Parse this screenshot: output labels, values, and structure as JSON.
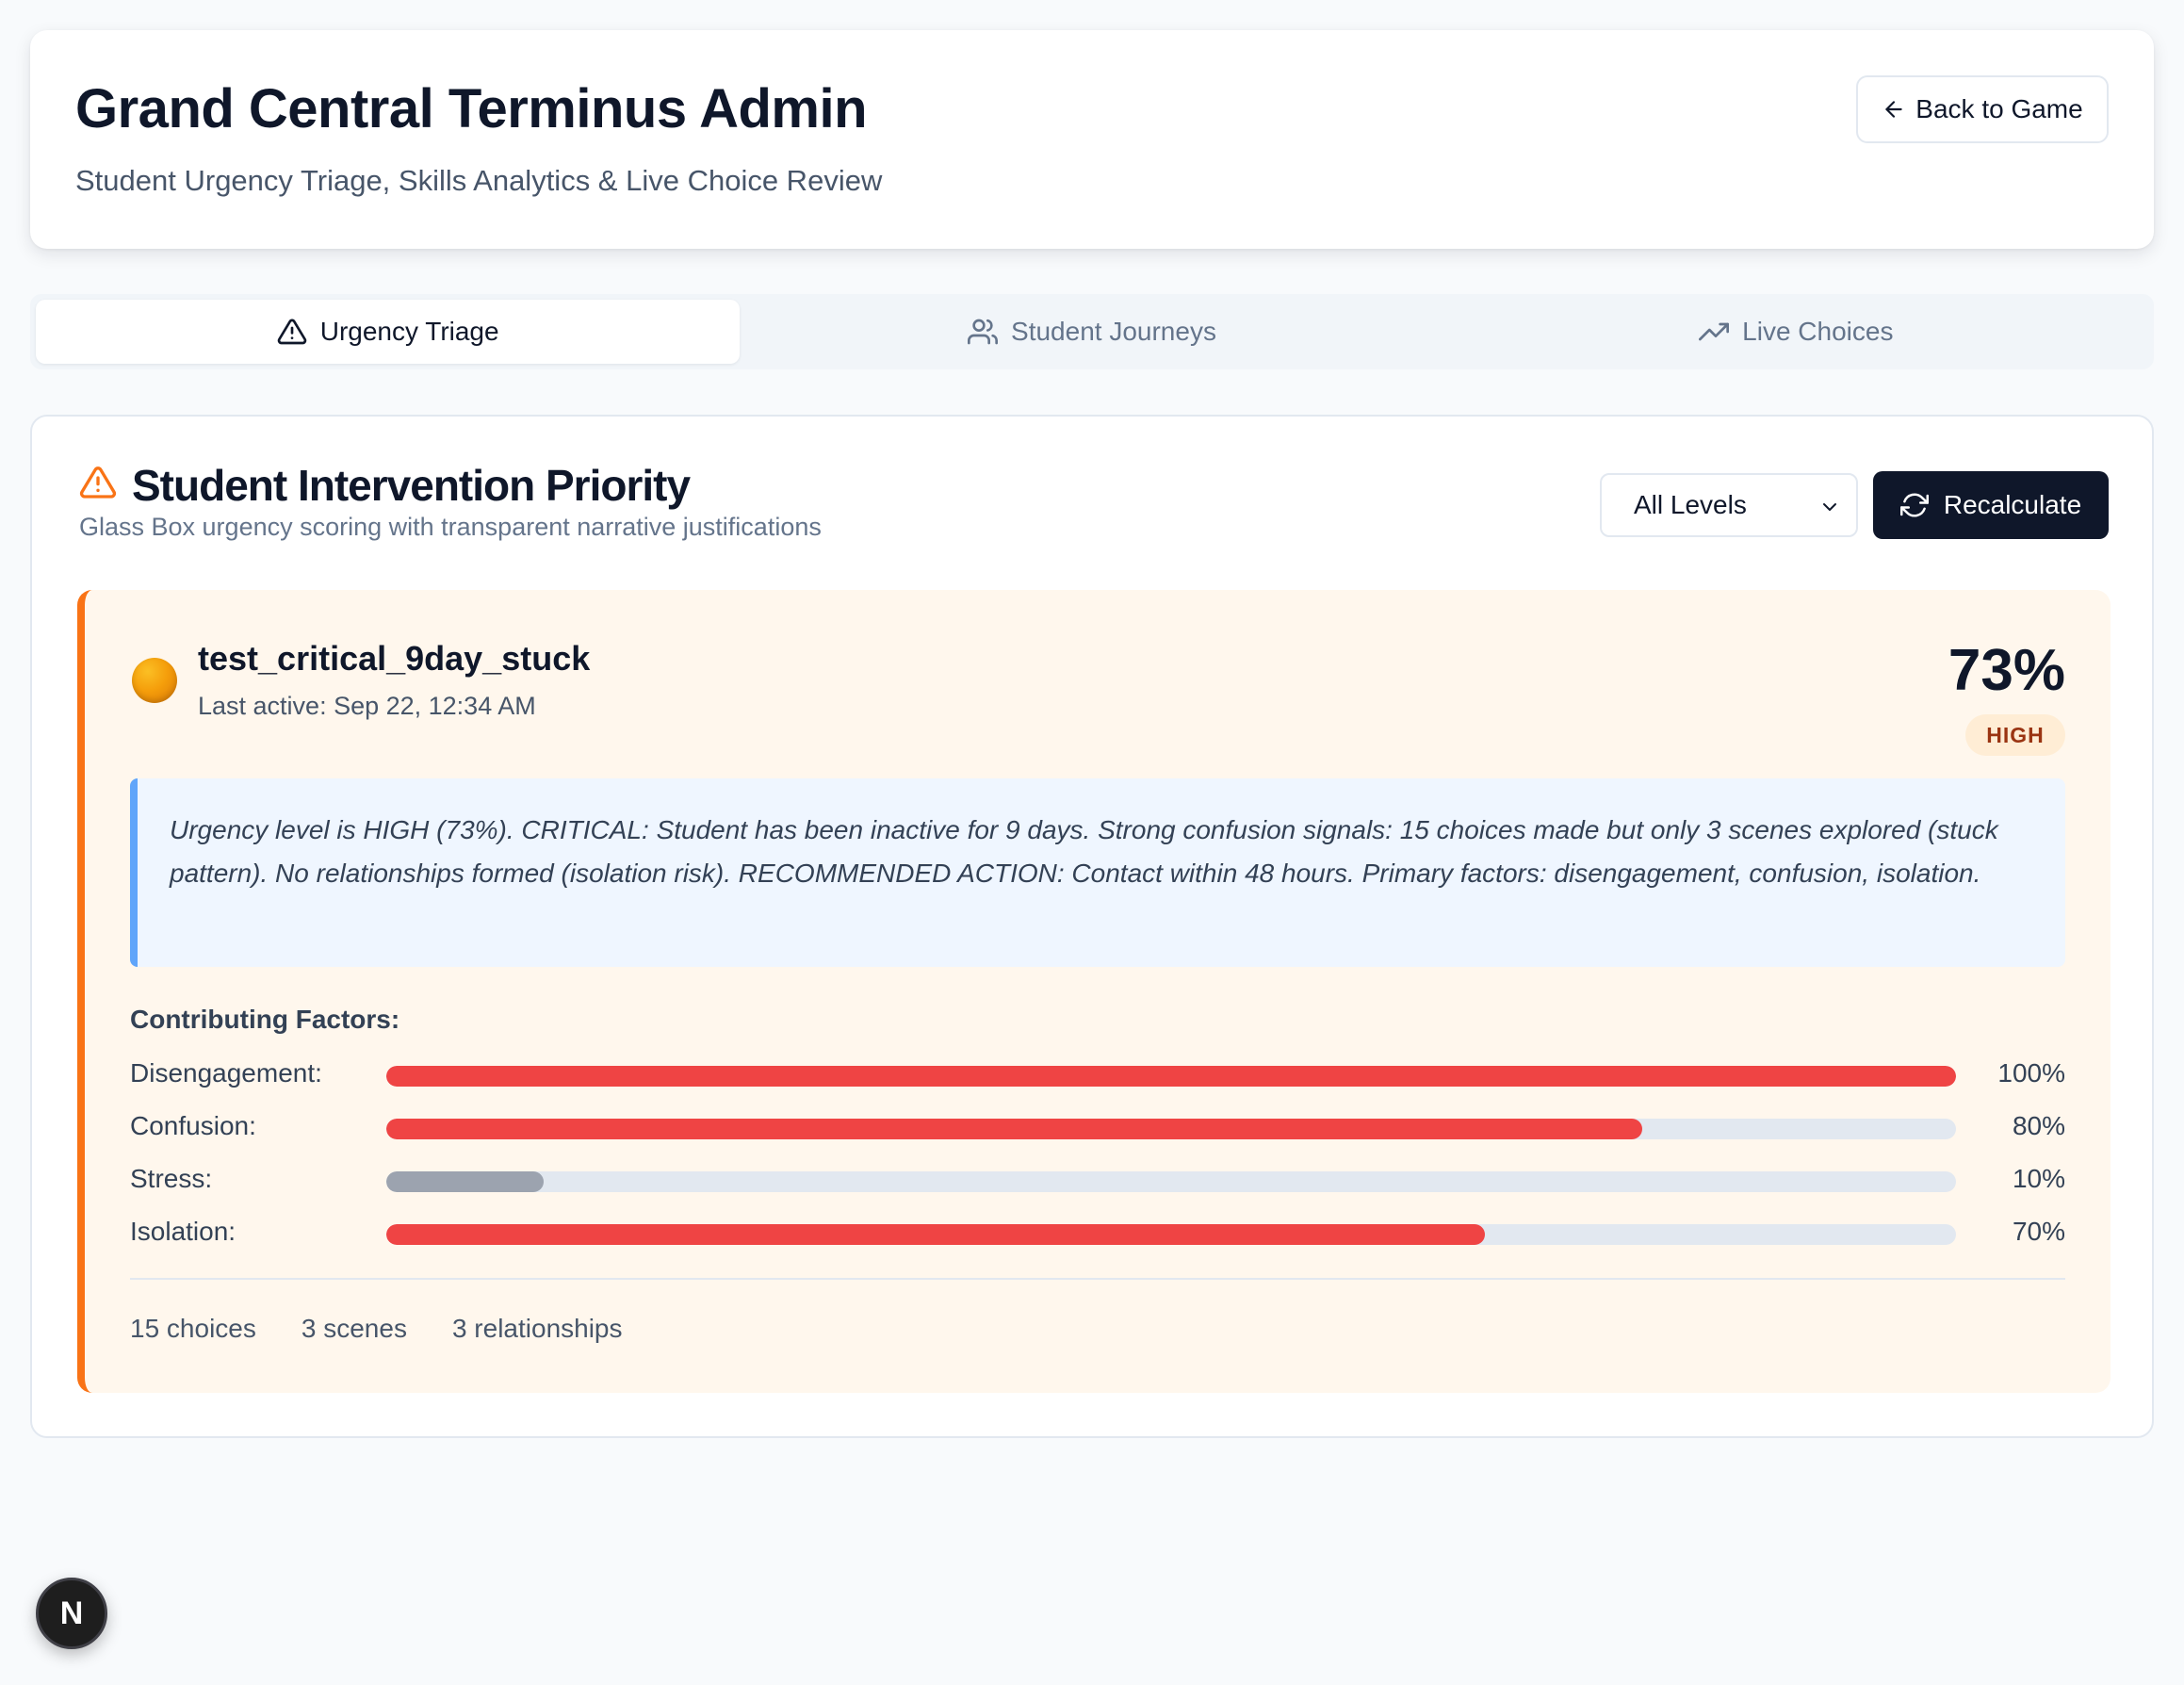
{
  "header": {
    "title": "Grand Central Terminus Admin",
    "subtitle": "Student Urgency Triage, Skills Analytics & Live Choice Review",
    "back_label": "Back to Game"
  },
  "tabs": [
    {
      "label": "Urgency Triage",
      "icon": "alert-triangle-icon",
      "active": true
    },
    {
      "label": "Student Journeys",
      "icon": "users-icon",
      "active": false
    },
    {
      "label": "Live Choices",
      "icon": "trending-up-icon",
      "active": false
    }
  ],
  "section": {
    "title": "Student Intervention Priority",
    "description": "Glass Box urgency scoring with transparent narrative justifications",
    "filter_value": "All Levels",
    "recalculate_label": "Recalculate"
  },
  "student": {
    "name": "test_critical_9day_stuck",
    "last_active": "Last active: Sep 22, 12:34 AM",
    "score": "73%",
    "level": "HIGH",
    "narrative": "Urgency level is HIGH (73%). CRITICAL: Student has been inactive for 9 days. Strong confusion signals: 15 choices made but only 3 scenes explored (stuck pattern). No relationships formed (isolation risk). RECOMMENDED ACTION: Contact within 48 hours. Primary factors: disengagement, confusion, isolation.",
    "factors_heading": "Contributing Factors:",
    "factors": [
      {
        "label": "Disengagement:",
        "value": "100%",
        "fraction": 1.0,
        "color": "#ef4444"
      },
      {
        "label": "Confusion:",
        "value": "80%",
        "fraction": 0.8,
        "color": "#ef4444"
      },
      {
        "label": "Stress:",
        "value": "10%",
        "fraction": 0.1,
        "color": "#9ca3af"
      },
      {
        "label": "Isolation:",
        "value": "70%",
        "fraction": 0.7,
        "color": "#ef4444"
      }
    ],
    "stats": {
      "choices": "15 choices",
      "scenes": "3 scenes",
      "relationships": "3 relationships"
    }
  },
  "colors": {
    "accent_orange": "#f97316",
    "narrative_border": "#60a5fa",
    "primary_dark": "#0f172a"
  },
  "dev_badge": "N"
}
